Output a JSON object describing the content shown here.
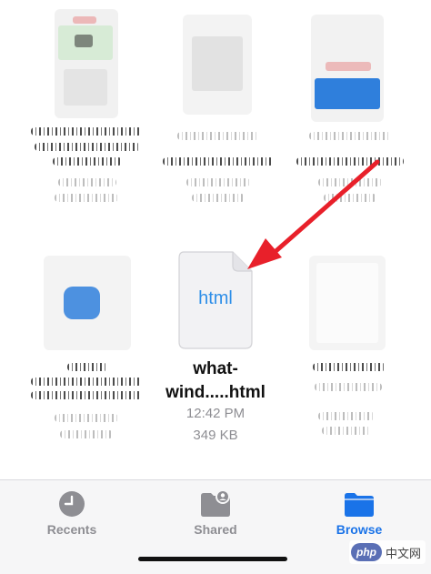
{
  "file": {
    "type_label": "html",
    "name_line1": "what-",
    "name_line2": "wind.....html",
    "time": "12:42 PM",
    "size": "349 KB"
  },
  "tabs": [
    {
      "label": "Recents",
      "icon": "clock-icon",
      "active": false
    },
    {
      "label": "Shared",
      "icon": "shared-folder-icon",
      "active": false
    },
    {
      "label": "Browse",
      "icon": "folder-icon",
      "active": true
    }
  ],
  "colors": {
    "accent": "#1a73e8",
    "inactive": "#8e8e93",
    "arrow": "#e8202a",
    "doc_text": "#2f8fe8"
  },
  "watermark": {
    "logo": "php",
    "text": "中文网"
  }
}
